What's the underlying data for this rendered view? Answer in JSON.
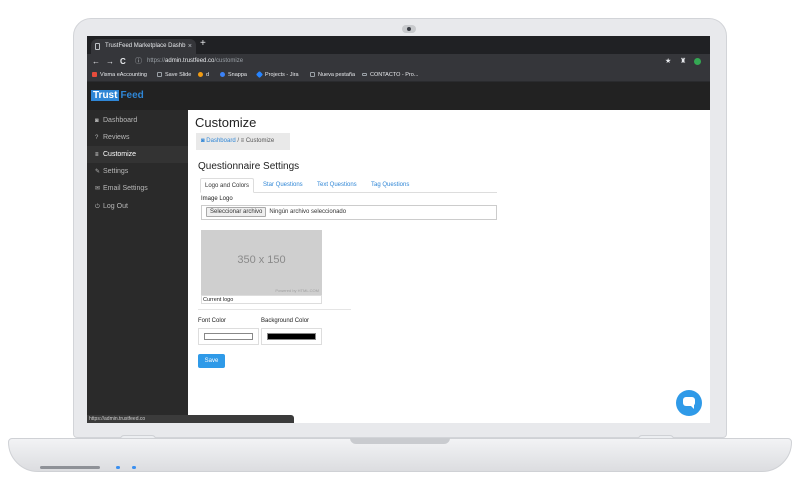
{
  "browser": {
    "tab_title": "TrustFeed Marketplace Dashb",
    "tab_close": "×",
    "new_tab": "+",
    "nav_back": "←",
    "nav_forward": "→",
    "nav_reload": "C",
    "url_scheme": "https://",
    "url_host": "admin.trustfeed.co",
    "url_path": "/customize",
    "bookmarks": [
      {
        "label": "Visma eAccounting",
        "color": "#e74c3c"
      },
      {
        "label": "Save Slide",
        "color": "#9aa0a6"
      },
      {
        "label": "d",
        "color": "#f39c12"
      },
      {
        "label": "Snappa",
        "color": "#3b82f6"
      },
      {
        "label": "Projects - Jira",
        "color": "#2684ff"
      },
      {
        "label": "Nueva pestaña",
        "color": "#9aa0a6"
      },
      {
        "label": "CONTACTO - Pro...",
        "color": "#9aa0a6"
      }
    ],
    "status_url": "https://admin.trustfeed.co"
  },
  "app": {
    "logo_trust": "Trust",
    "logo_feed": "Feed",
    "brand_color": "#2f86d6"
  },
  "sidebar": {
    "items": [
      {
        "label": "Dashboard",
        "icon": "dashboard-icon",
        "glyph": "◙"
      },
      {
        "label": "Reviews",
        "icon": "question-icon",
        "glyph": "?"
      },
      {
        "label": "Customize",
        "icon": "sliders-icon",
        "glyph": "≡",
        "active": true
      },
      {
        "label": "Settings",
        "icon": "wrench-icon",
        "glyph": "✎"
      },
      {
        "label": "Email Settings",
        "icon": "envelope-icon",
        "glyph": "✉"
      },
      {
        "label": "Log Out",
        "icon": "power-icon",
        "glyph": "⏻"
      }
    ]
  },
  "main": {
    "title": "Customize",
    "breadcrumb_home": "Dashboard",
    "breadcrumb_sep": "/",
    "breadcrumb_current": "Customize",
    "section_title": "Questionnaire Settings",
    "tabs": [
      "Logo and Colors",
      "Star Questions",
      "Text Questions",
      "Tag Questions"
    ],
    "image_logo_label": "Image Logo",
    "file_button": "Seleccionar archivo",
    "file_status": "Ningún archivo seleccionado",
    "placeholder_text": "350 x 150",
    "placeholder_credit": "Powered by HTML.COM",
    "current_logo_label": "Current logo",
    "font_color_label": "Font Color",
    "font_color_value": "#ffffff",
    "background_color_label": "Background Color",
    "background_color_value": "#000000",
    "save_label": "Save"
  }
}
